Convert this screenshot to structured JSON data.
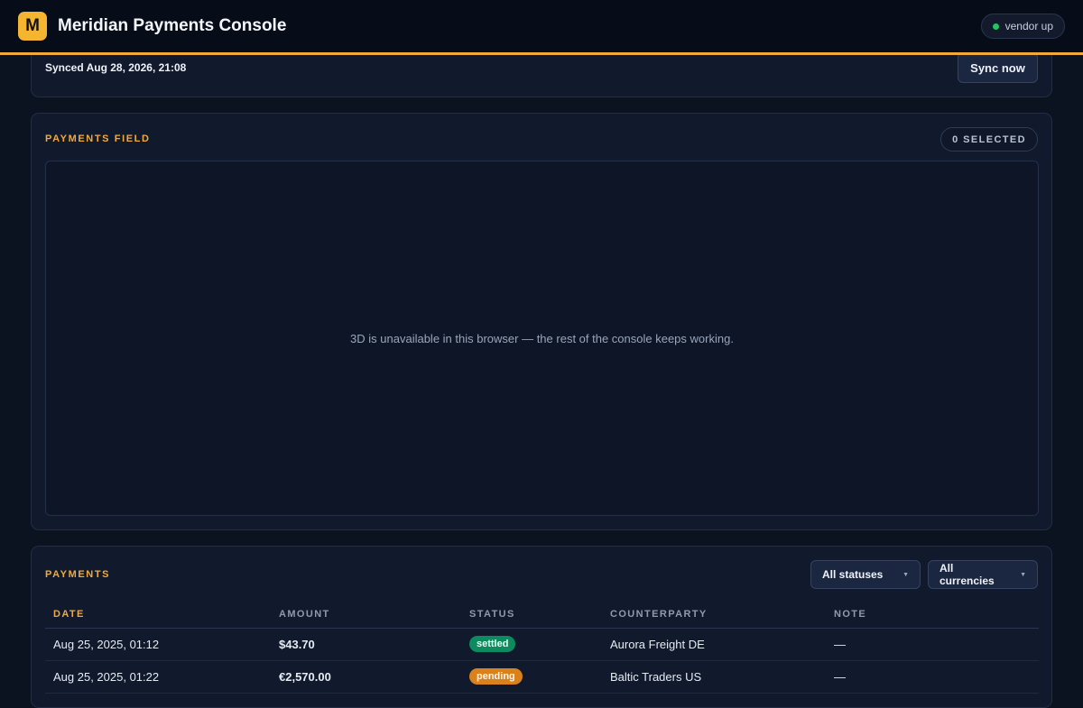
{
  "app": {
    "logo_letter": "M",
    "title": "Meridian Payments Console"
  },
  "vendor_status": {
    "label": "vendor up",
    "color": "#22c55e"
  },
  "sync": {
    "text": "Synced Aug 28, 2026, 21:08",
    "button_label": "Sync now"
  },
  "field": {
    "title": "PAYMENTS FIELD",
    "selected_label": "0 SELECTED",
    "message": "3D is unavailable in this browser — the rest of the console keeps working."
  },
  "payments": {
    "title": "PAYMENTS",
    "status_filter": "All statuses",
    "currency_filter": "All currencies",
    "columns": [
      "DATE",
      "AMOUNT",
      "STATUS",
      "COUNTERPARTY",
      "NOTE"
    ],
    "rows": [
      {
        "date": "Aug 25, 2025, 01:12",
        "amount": "$43.70",
        "status": "settled",
        "counterparty": "Aurora Freight DE",
        "note": "—"
      },
      {
        "date": "Aug 25, 2025, 01:22",
        "amount": "€2,570.00",
        "status": "pending",
        "counterparty": "Baltic Traders US",
        "note": "—"
      }
    ]
  },
  "colors": {
    "accent": "#f2a93b",
    "settled": "#0e8a5f",
    "pending": "#d9821c"
  }
}
